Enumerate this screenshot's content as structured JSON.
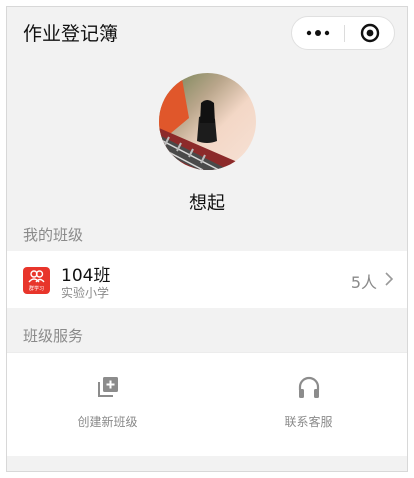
{
  "nav": {
    "title": "作业登记簿",
    "more_icon": "more-dots-icon",
    "close_icon": "target-circle-icon"
  },
  "profile": {
    "username": "想起"
  },
  "my_classes": {
    "section_label": "我的班级",
    "items": [
      {
        "name": "104班",
        "school": "实验小学",
        "member_count": "5人",
        "logo_text": "群学习",
        "logo_color": "#e8352b"
      }
    ]
  },
  "class_services": {
    "section_label": "班级服务",
    "items": [
      {
        "label": "创建新班级",
        "icon": "add-stack-icon"
      },
      {
        "label": "联系客服",
        "icon": "headset-icon"
      }
    ]
  },
  "colors": {
    "background": "#f2f2f2",
    "card": "#ffffff",
    "muted_text": "#8a8a8a",
    "accent": "#e8352b"
  }
}
